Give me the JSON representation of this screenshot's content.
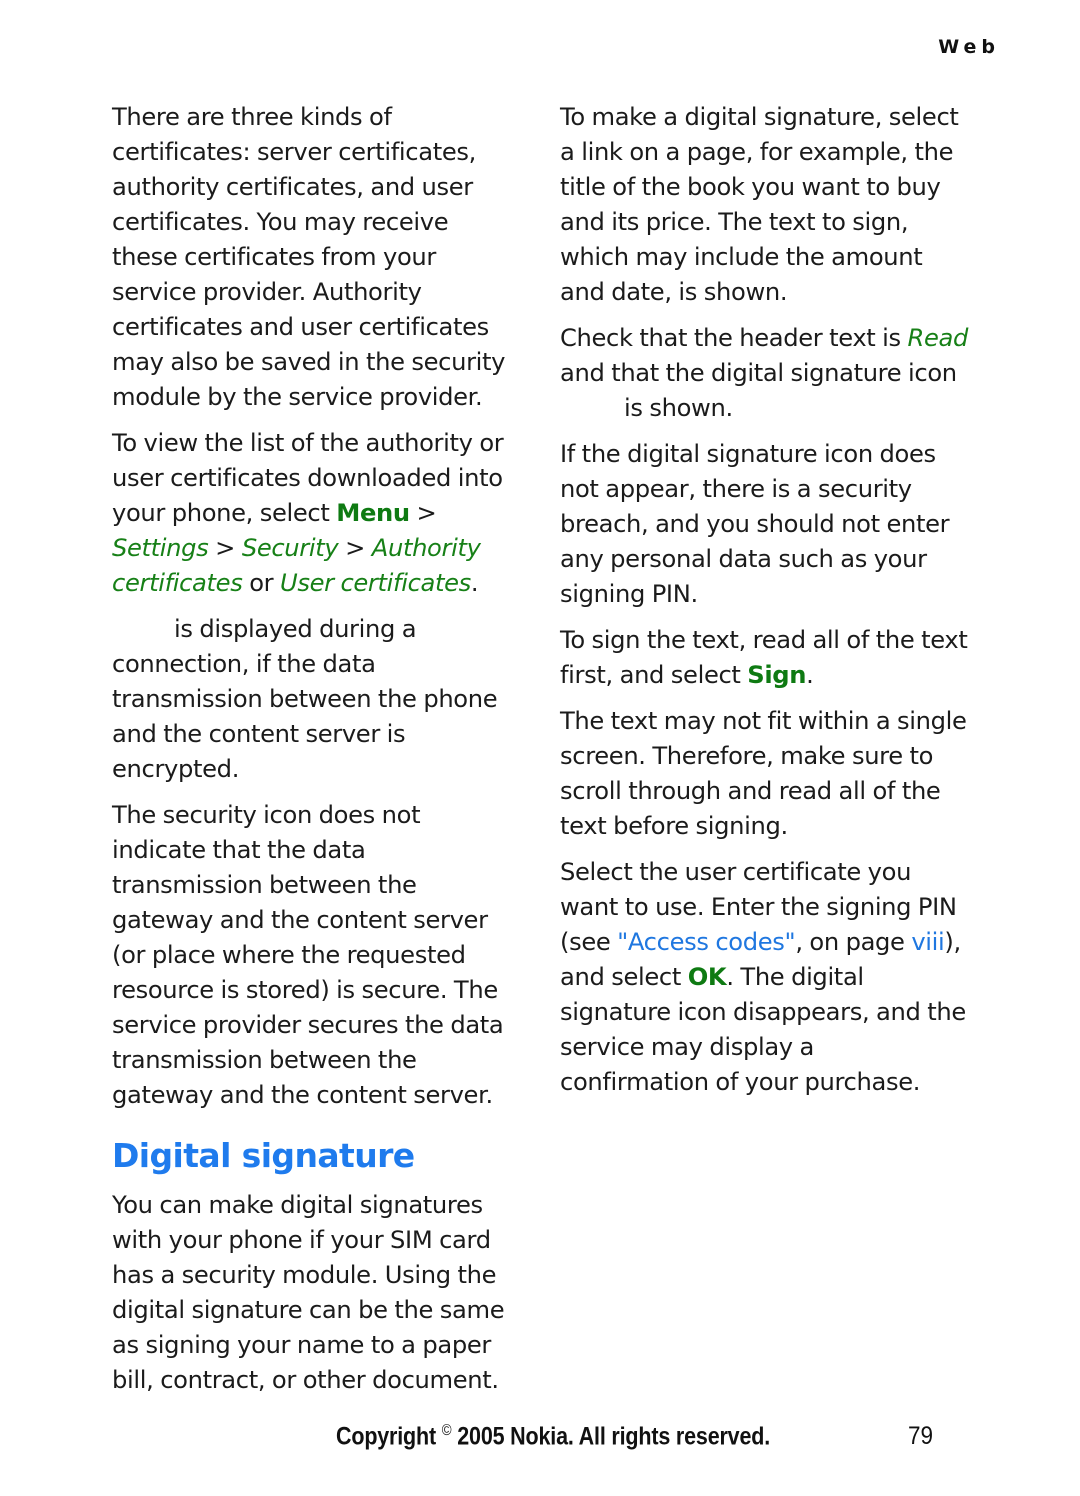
{
  "header": {
    "running_head": "Web"
  },
  "colors": {
    "link_blue": "#1f77e0",
    "heading_blue": "#1f7bed",
    "key_green": "#0e7a12",
    "text_black": "#1b1b1b"
  },
  "left_column": {
    "paragraph_1": "There are three kinds of certificates: server certificates, authority certificates, and user certificates. You may receive these certificates from your service provider. Authority certificates and user certificates may also be saved in the security module by the service provider.",
    "paragraph_2": {
      "lead": "To view the list of the authority or user certificates downloaded into your phone, select ",
      "key": "Menu",
      "sep_1": " > ",
      "path_1": "Settings",
      "sep_2": " > ",
      "path_2": "Security",
      "sep_3": " > ",
      "path_3": "Authority certificates",
      "conjunction": " or ",
      "path_4": "User certificates",
      "trailing": "."
    },
    "paragraph_3": "is displayed during a connection, if the data transmission between the phone and the content server is encrypted.",
    "paragraph_4": "The security icon does not indicate that the data transmission between the gateway and the content server (or place where the requested resource is stored) is secure. The service provider secures the data transmission between the gateway and the content server.",
    "section_title": "Digital signature",
    "paragraph_5": "You can make digital signatures with your phone if your SIM card has a security module. Using the digital signature can be the same as signing your name to a paper bill, contract, or other document."
  },
  "right_column": {
    "paragraph_1": "To make a digital signature, select a link on a page, for example, the title of the book you want to buy and its price. The text to sign, which may include the amount and date, is shown.",
    "paragraph_2": {
      "lead": "Check that the header text is ",
      "key": "Read",
      "middle": " and that the digital signature icon ",
      "tail": "is shown."
    },
    "paragraph_3": "If the digital signature icon does not appear, there is a security breach, and you should not enter any personal data such as your signing PIN.",
    "paragraph_4": {
      "lead": "To sign the text, read all of the text first, and select ",
      "key": "Sign",
      "trailing": "."
    },
    "paragraph_5": "The text may not fit within a single screen. Therefore, make sure to scroll through and read all of the text before signing.",
    "paragraph_6": {
      "lead": "Select the user certificate you want to use. Enter the signing PIN (see ",
      "link_1": "\"Access codes\"",
      "middle_1": ", on page ",
      "link_2": "viii",
      "middle_2": "), and select ",
      "key": "OK",
      "tail": ". The digital signature icon disappears, and the service may display a confirmation of your purchase."
    }
  },
  "footer": {
    "copyright_pre": "Copyright ",
    "copyright_symbol": "©",
    "copyright_post": " 2005 Nokia. All rights reserved.",
    "page_number": "79"
  }
}
